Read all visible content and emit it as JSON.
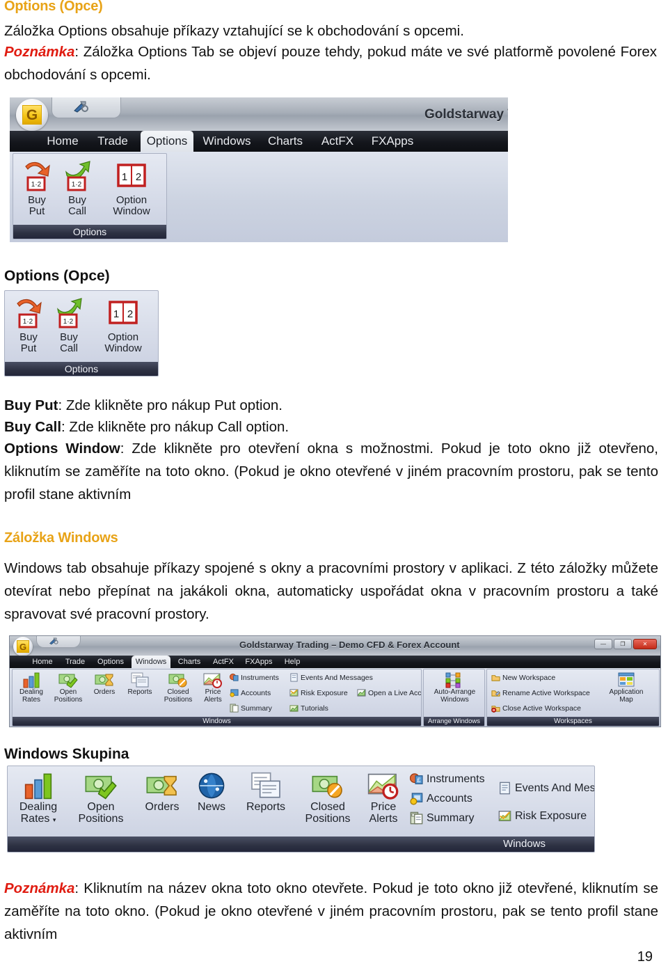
{
  "page": {
    "number": "19"
  },
  "sections": {
    "options_heading": "Options (Opce)",
    "options_intro": "Záložka Options obsahuje příkazy vztahující se k obchodování s opcemi.",
    "options_note_label": "Poznámka",
    "options_note_text": ": Záložka Options Tab se objeví pouze tehdy, pokud máte ve své platformě povolené Forex obchodování s opcemi.",
    "options_group_heading": "Options (Opce)",
    "buy_put_label": "Buy Put",
    "buy_put_desc": ": Zde klikněte pro nákup Put option.",
    "buy_call_label": "Buy Call",
    "buy_call_desc": ": Zde klikněte pro nákup Call option.",
    "options_window_label": "Options Window",
    "options_window_desc": ": Zde klikněte pro otevření okna s možnostmi. Pokud je toto okno již otevřeno, kliknutím se zaměříte na toto okno. (Pokud je okno otevřené v jiném pracovním prostoru, pak se tento profil stane aktivním",
    "windows_heading": "Záložka Windows",
    "windows_intro": "Windows tab obsahuje příkazy spojené s okny a pracovními prostory v aplikaci. Z této záložky můžete otevírat nebo přepínat na jakákoli okna, automaticky uspořádat okna v pracovním prostoru a také spravovat své pracovní prostory.",
    "windows_group_heading": "Windows Skupina",
    "bottom_note_label": "Poznámka",
    "bottom_note_text": ": Kliknutím na název okna toto okno otevřete. Pokud je toto okno již otevřené, kliknutím se zaměříte na toto okno. (Pokud je okno otevřené v jiném pracovním prostoru, pak se tento profil stane aktivním"
  },
  "screenshot_options_ribbon": {
    "app_title": "Goldstarway T",
    "logo_letter": "G",
    "qat_icon": "tools-icon",
    "tabs": [
      {
        "label": "Home",
        "active": false
      },
      {
        "label": "Trade",
        "active": false
      },
      {
        "label": "Options",
        "active": true
      },
      {
        "label": "Windows",
        "active": false
      },
      {
        "label": "Charts",
        "active": false
      },
      {
        "label": "ActFX",
        "active": false
      },
      {
        "label": "FXApps",
        "active": false
      }
    ],
    "group_title": "Options",
    "buttons": [
      {
        "line1": "Buy",
        "line2": "Put",
        "icon": "buy-put-icon"
      },
      {
        "line1": "Buy",
        "line2": "Call",
        "icon": "buy-call-icon"
      },
      {
        "line1": "Option",
        "line2": "Window",
        "icon": "option-window-icon"
      }
    ]
  },
  "screenshot_options_group": {
    "group_title": "Options",
    "buttons": [
      {
        "line1": "Buy",
        "line2": "Put",
        "icon": "buy-put-icon"
      },
      {
        "line1": "Buy",
        "line2": "Call",
        "icon": "buy-call-icon"
      },
      {
        "line1": "Option",
        "line2": "Window",
        "icon": "option-window-icon"
      }
    ]
  },
  "screenshot_windows_ribbon": {
    "app_title": "Goldstarway Trading – Demo CFD & Forex Account",
    "logo_letter": "G",
    "qat_icon": "tools-icon",
    "window_buttons": [
      {
        "name": "minimize-button",
        "glyph": "—"
      },
      {
        "name": "maximize-button",
        "glyph": "❐"
      },
      {
        "name": "close-button",
        "glyph": "✕"
      }
    ],
    "tabs": [
      {
        "label": "Home",
        "active": false
      },
      {
        "label": "Trade",
        "active": false
      },
      {
        "label": "Options",
        "active": false
      },
      {
        "label": "Windows",
        "active": true
      },
      {
        "label": "Charts",
        "active": false
      },
      {
        "label": "ActFX",
        "active": false
      },
      {
        "label": "FXApps",
        "active": false
      },
      {
        "label": "Help",
        "active": false
      }
    ],
    "groups": [
      {
        "title": "Windows"
      },
      {
        "title": "Arrange Windows"
      },
      {
        "title": "Workspaces"
      }
    ],
    "big_buttons": [
      {
        "line1": "Dealing",
        "line2": "Rates",
        "dropdown": true,
        "icon": "bar-chart-icon"
      },
      {
        "line1": "Open",
        "line2": "Positions",
        "dropdown": false,
        "icon": "money-check-icon"
      },
      {
        "line1": "Orders",
        "line2": "",
        "dropdown": false,
        "icon": "orders-icon"
      },
      {
        "line1": "Reports",
        "line2": "",
        "dropdown": false,
        "icon": "reports-icon"
      },
      {
        "line1": "Closed",
        "line2": "Positions",
        "dropdown": false,
        "icon": "money-block-icon"
      },
      {
        "line1": "Price",
        "line2": "Alerts",
        "dropdown": false,
        "icon": "price-alerts-icon"
      }
    ],
    "small_items_col1": [
      {
        "label": "Instruments",
        "icon": "instruments-icon"
      },
      {
        "label": "Accounts",
        "icon": "accounts-icon"
      },
      {
        "label": "Summary",
        "icon": "summary-icon"
      }
    ],
    "small_items_col2": [
      {
        "label": "Events And Messages",
        "icon": "events-icon"
      },
      {
        "label": "Risk Exposure",
        "icon": "risk-exposure-icon"
      },
      {
        "label": "Tutorials",
        "icon": "tutorials-icon"
      }
    ],
    "small_items_col3": [
      {
        "label": "Open a Live Account",
        "icon": "live-account-icon"
      }
    ],
    "arrange_button": {
      "line1": "Auto-Arrange",
      "line2": "Windows",
      "icon": "auto-arrange-icon"
    },
    "workspace_items": [
      {
        "label": "New Workspace",
        "icon": "new-workspace-icon"
      },
      {
        "label": "Rename Active Workspace",
        "icon": "rename-workspace-icon"
      },
      {
        "label": "Close Active Workspace",
        "icon": "close-workspace-icon"
      }
    ],
    "app_map_button": {
      "line1": "Application",
      "line2": "Map",
      "dropdown": true,
      "icon": "application-map-icon"
    }
  },
  "screenshot_windows_group": {
    "group_title": "Windows",
    "big_buttons": [
      {
        "line1": "Dealing",
        "line2": "Rates",
        "dropdown": true,
        "icon": "bar-chart-icon"
      },
      {
        "line1": "Open",
        "line2": "Positions",
        "dropdown": false,
        "icon": "money-check-icon"
      },
      {
        "line1": "Orders",
        "line2": "",
        "dropdown": false,
        "icon": "orders-icon"
      },
      {
        "line1": "News",
        "line2": "",
        "dropdown": false,
        "icon": "news-globe-icon"
      },
      {
        "line1": "Reports",
        "line2": "",
        "dropdown": false,
        "icon": "reports-icon"
      },
      {
        "line1": "Closed",
        "line2": "Positions",
        "dropdown": false,
        "icon": "money-block-icon"
      },
      {
        "line1": "Price",
        "line2": "Alerts",
        "dropdown": false,
        "icon": "price-alerts-icon"
      }
    ],
    "small_items_col1": [
      {
        "label": "Instruments",
        "icon": "instruments-icon"
      },
      {
        "label": "Accounts",
        "icon": "accounts-icon"
      },
      {
        "label": "Summary",
        "icon": "summary-icon"
      }
    ],
    "small_items_col2": [
      {
        "label": "Events And Messages",
        "icon": "events-icon"
      },
      {
        "label": "Risk Exposure",
        "icon": "risk-exposure-icon"
      }
    ]
  },
  "colors": {
    "heading_orange": "#e8a317",
    "note_red": "#e01b10",
    "body_black": "#111111",
    "ribbon_dark": "#14161c",
    "group_title_bg": "#2d3142",
    "logo_gold": "#f5c518"
  }
}
